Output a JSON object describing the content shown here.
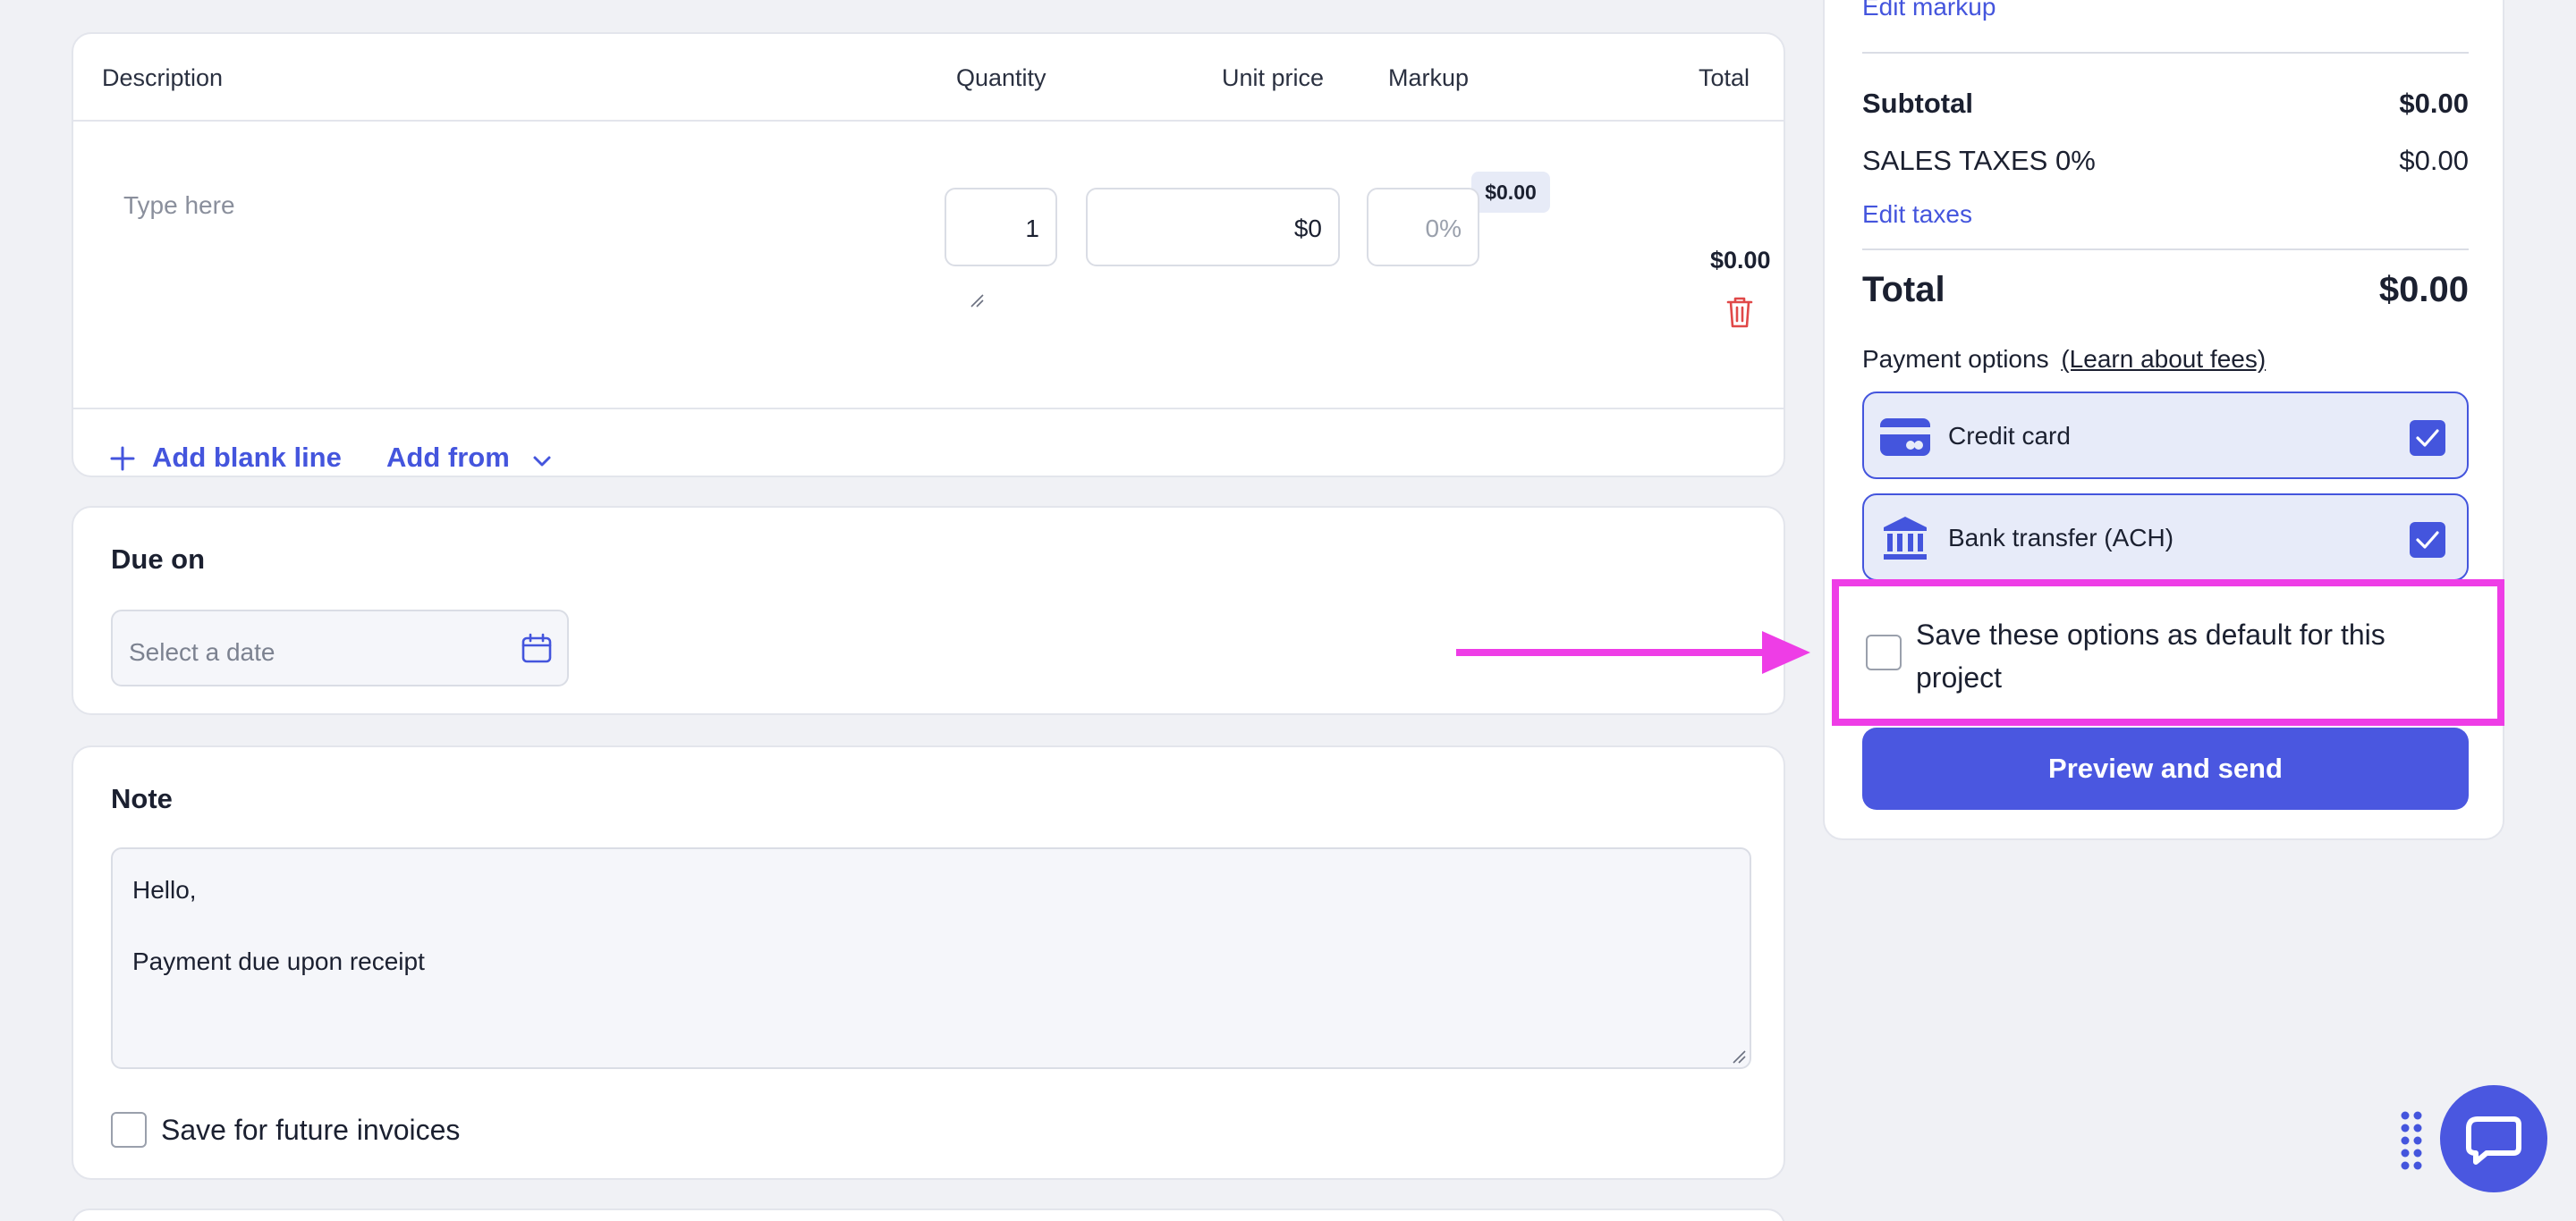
{
  "colors": {
    "accent": "#4455dd",
    "highlight": "#ee3de6",
    "danger": "#e04848"
  },
  "line_items": {
    "headers": {
      "description": "Description",
      "quantity": "Quantity",
      "unit_price": "Unit price",
      "markup": "Markup",
      "total": "Total"
    },
    "row": {
      "description_placeholder": "Type here",
      "quantity": "1",
      "unit_price": "$0",
      "markup_amount": "$0.00",
      "markup_placeholder": "0%",
      "total": "$0.00"
    },
    "add_blank_line": "Add blank line",
    "add_from": "Add from"
  },
  "due_on": {
    "title": "Due on",
    "placeholder": "Select a date"
  },
  "note": {
    "title": "Note",
    "line1": "Hello,",
    "line2": "Payment due upon receipt",
    "save_label": "Save for future invoices"
  },
  "summary": {
    "edit_markup": "Edit markup",
    "subtotal_label": "Subtotal",
    "subtotal_value": "$0.00",
    "tax_label": "SALES TAXES 0%",
    "tax_value": "$0.00",
    "edit_taxes": "Edit taxes",
    "total_label": "Total",
    "total_value": "$0.00",
    "payment_options_label": "Payment options",
    "learn_fees": "(Learn about fees)",
    "options": [
      {
        "label": "Credit card",
        "icon": "credit-card-icon",
        "checked": true
      },
      {
        "label": "Bank transfer (ACH)",
        "icon": "bank-icon",
        "checked": true
      }
    ],
    "save_default_line1": "Save these options as default for this",
    "save_default_line2": "project",
    "preview_button": "Preview and send"
  }
}
